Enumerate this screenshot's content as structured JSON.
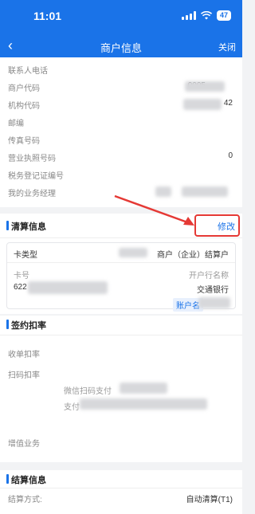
{
  "status": {
    "time": "11:01",
    "battery": "47"
  },
  "nav": {
    "back_glyph": "‹",
    "title": "商户信息",
    "close": "关闭"
  },
  "info": {
    "rows": [
      {
        "label": "联系人电话",
        "value": ""
      },
      {
        "label": "商户代码",
        "value": "0005"
      },
      {
        "label": "机构代码",
        "value": "42"
      },
      {
        "label": "邮编",
        "value": ""
      },
      {
        "label": "传真号码",
        "value": ""
      },
      {
        "label": "营业执照号码",
        "value": "0"
      },
      {
        "label": "税务登记证编号",
        "value": ""
      },
      {
        "label": "我的业务经理",
        "value": ""
      }
    ]
  },
  "settlement": {
    "title": "清算信息",
    "modify": "修改",
    "card_type_label": "卡类型",
    "card_type_value": "商户（企业）结算户",
    "card_no_label": "卡号",
    "card_no_value": "622",
    "bank_label": "开户行名称",
    "bank_value": "交通银行",
    "account_name": "账户名"
  },
  "sign": {
    "title": "签约扣率",
    "receipt": "收单扣率",
    "scan": "扫码扣率",
    "wechat": "微信扫码支付",
    "alipay": "支付",
    "value_added": "增值业务"
  },
  "settle_info": {
    "title": "结算信息",
    "method_label": "结算方式:",
    "method_value": "自动清算(T1)"
  },
  "colors": {
    "primary": "#1a73e8",
    "annotation": "#e53935"
  }
}
